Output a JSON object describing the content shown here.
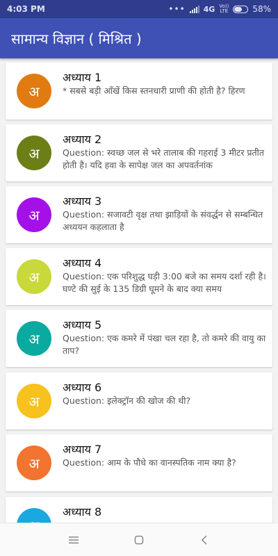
{
  "status": {
    "time": "4:03 PM",
    "network": "4G",
    "volte_top": "Vo))",
    "volte_bottom": "LTE",
    "battery": "58%",
    "battery_level": 0.58
  },
  "appbar": {
    "title": "सामान्य विज्ञान ( मिश्रित )"
  },
  "items": [
    {
      "avatar": "अ",
      "color": "#e07b12",
      "title": "अध्याय 1",
      "body": "*  सबसे बड़ी आँखें किस स्तनधारी प्राणी की होती है? हिरण"
    },
    {
      "avatar": "अ",
      "color": "#6b7f16",
      "title": "अध्याय 2",
      "body": "Question:   स्वच्छ जल से भरे तालाब की गहराई 3 मीटर प्रतीत होती है। यदि हवा के सापेक्ष जल का अपवर्तनांक"
    },
    {
      "avatar": "अ",
      "color": "#a510e8",
      "title": "अध्याय 3",
      "body": "Question:  सजावटी वृक्ष तथा झाड़ियों के संवर्द्धन से सम्बन्धित अध्ययन कहलाता है"
    },
    {
      "avatar": "अ",
      "color": "#c9d83a",
      "title": "अध्याय 4",
      "body": "Question:   एक परिशुद्ध घड़ी 3:00 बजे का समय दर्शा रही है। घण्टे की सुई के 135 डिग्री घूमने के बाद क्या समय"
    },
    {
      "avatar": "अ",
      "color": "#0aaaa0",
      "title": "अध्याय 5",
      "body": "Question:    एक कमरे में पंखा चल रहा है, तो कमरे की वायु का ताप?"
    },
    {
      "avatar": "अ",
      "color": "#f7c21e",
      "title": "अध्याय 6",
      "body": "Question:    इलेक्ट्रॉन की खोज की थी?"
    },
    {
      "avatar": "अ",
      "color": "#f2742e",
      "title": "अध्याय 7",
      "body": "Question:  आम के पौधे का वानस्पतिक नाम क्या है?"
    },
    {
      "avatar": "अ",
      "color": "#1aa8e0",
      "title": "अध्याय 8",
      "body": ""
    }
  ],
  "nav": {
    "menu_icon": "menu-icon",
    "home_icon": "square-home-icon",
    "back_icon": "back-chevron-icon"
  }
}
